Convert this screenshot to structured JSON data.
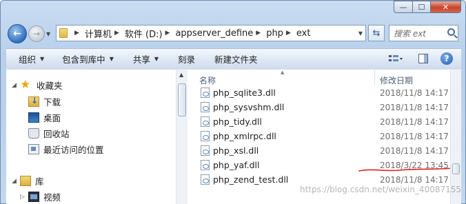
{
  "window": {
    "controls": {
      "minimize": "—",
      "maximize": "☐",
      "close": "✕"
    }
  },
  "nav": {
    "back": "←",
    "forward": "→"
  },
  "address": {
    "crumbs": [
      "计算机",
      "软件 (D:)",
      "appserver_define",
      "php",
      "ext"
    ]
  },
  "search": {
    "placeholder": "搜索 ext"
  },
  "toolbar": {
    "items": [
      {
        "label": "组织",
        "dropdown": true
      },
      {
        "label": "包含到库中",
        "dropdown": true
      },
      {
        "label": "共享",
        "dropdown": true
      },
      {
        "label": "刻录",
        "dropdown": false
      },
      {
        "label": "新建文件夹",
        "dropdown": false
      }
    ],
    "help": "?"
  },
  "navpane": {
    "items": [
      {
        "label": "收藏夹",
        "icon": "star-icon"
      },
      {
        "label": "下载",
        "icon": "download-folder-icon"
      },
      {
        "label": "桌面",
        "icon": "desktop-icon"
      },
      {
        "label": "回收站",
        "icon": "recycle-bin-icon"
      },
      {
        "label": "最近访问的位置",
        "icon": "recent-places-icon"
      },
      {
        "label": "库",
        "icon": "library-icon"
      },
      {
        "label": "视频",
        "icon": "video-icon"
      }
    ]
  },
  "filelist": {
    "columns": {
      "name": "名称",
      "modified": "修改日期"
    },
    "rows": [
      {
        "name": "php_sqlite3.dll",
        "modified": "2018/11/8 14:17"
      },
      {
        "name": "php_sysvshm.dll",
        "modified": "2018/11/8 14:17"
      },
      {
        "name": "php_tidy.dll",
        "modified": "2018/11/8 14:17"
      },
      {
        "name": "php_xmlrpc.dll",
        "modified": "2018/11/8 14:17"
      },
      {
        "name": "php_xsl.dll",
        "modified": "2018/11/8 14:17"
      },
      {
        "name": "php_yaf.dll",
        "modified": "2018/3/22 13:45"
      },
      {
        "name": "php_zend_test.dll",
        "modified": "2018/11/8 14:17"
      }
    ]
  },
  "annotation": {
    "color": "#e02020"
  },
  "watermark": "https://blog.csdn.net/weixin_40087155"
}
